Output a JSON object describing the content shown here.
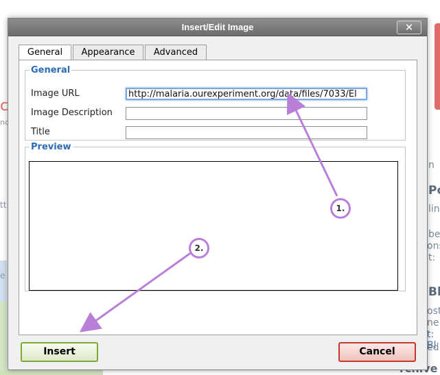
{
  "dialog": {
    "title": "Insert/Edit Image",
    "close_glyph": "✕",
    "tabs": [
      {
        "label": "General",
        "active": true
      },
      {
        "label": "Appearance",
        "active": false
      },
      {
        "label": "Advanced",
        "active": false
      }
    ],
    "general": {
      "legend": "General",
      "image_url_label": "Image URL",
      "image_url_value": "http://malaria.ourexperiment.org/data/files/7033/El",
      "image_description_label": "Image Description",
      "image_description_value": "",
      "title_label": "Title",
      "title_value": ""
    },
    "preview": {
      "legend": "Preview"
    },
    "buttons": {
      "insert": "Insert",
      "cancel": "Cancel"
    }
  },
  "annotations": {
    "step1": "1.",
    "step2": "2.",
    "color": "#b97fd8"
  },
  "background_fragments": {
    "right": [
      "n",
      "Po",
      "lin",
      "be",
      "ons",
      "t:",
      "Bl",
      "ost",
      "ne",
      "t: Bl",
      "ed",
      "rchive"
    ],
    "left": [
      "c",
      "nc",
      "tt",
      "e"
    ]
  },
  "colors": {
    "titlebar": "#7a7a7a",
    "legend": "#2b6cb5",
    "insert_border": "#7aa63a",
    "cancel_border": "#c0392b"
  },
  "icons": {
    "close": "close-icon"
  }
}
